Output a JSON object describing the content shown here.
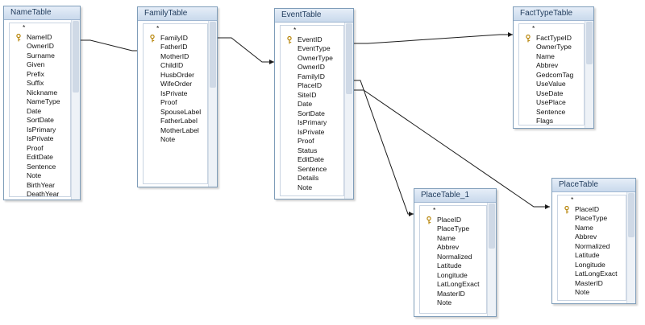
{
  "tables": {
    "name": {
      "title": "NameTable",
      "fields": [
        "*",
        "NameID",
        "OwnerID",
        "Surname",
        "Given",
        "Prefix",
        "Suffix",
        "Nickname",
        "NameType",
        "Date",
        "SortDate",
        "IsPrimary",
        "IsPrivate",
        "Proof",
        "EditDate",
        "Sentence",
        "Note",
        "BirthYear",
        "DeathYear"
      ]
    },
    "family": {
      "title": "FamilyTable",
      "fields": [
        "*",
        "FamilyID",
        "FatherID",
        "MotherID",
        "ChildID",
        "HusbOrder",
        "WifeOrder",
        "IsPrivate",
        "Proof",
        "SpouseLabel",
        "FatherLabel",
        "MotherLabel",
        "Note"
      ]
    },
    "event": {
      "title": "EventTable",
      "fields": [
        "*",
        "EventID",
        "EventType",
        "OwnerType",
        "OwnerID",
        "FamilyID",
        "PlaceID",
        "SiteID",
        "Date",
        "SortDate",
        "IsPrimary",
        "IsPrivate",
        "Proof",
        "Status",
        "EditDate",
        "Sentence",
        "Details",
        "Note"
      ]
    },
    "facttype": {
      "title": "FactTypeTable",
      "fields": [
        "*",
        "FactTypeID",
        "OwnerType",
        "Name",
        "Abbrev",
        "GedcomTag",
        "UseValue",
        "UseDate",
        "UsePlace",
        "Sentence",
        "Flags"
      ]
    },
    "place1": {
      "title": "PlaceTable_1",
      "fields": [
        "*",
        "PlaceID",
        "PlaceType",
        "Name",
        "Abbrev",
        "Normalized",
        "Latitude",
        "Longitude",
        "LatLongExact",
        "MasterID",
        "Note"
      ]
    },
    "place": {
      "title": "PlaceTable",
      "fields": [
        "*",
        "PlaceID",
        "PlaceType",
        "Name",
        "Abbrev",
        "Normalized",
        "Latitude",
        "Longitude",
        "LatLongExact",
        "MasterID",
        "Note"
      ]
    }
  }
}
